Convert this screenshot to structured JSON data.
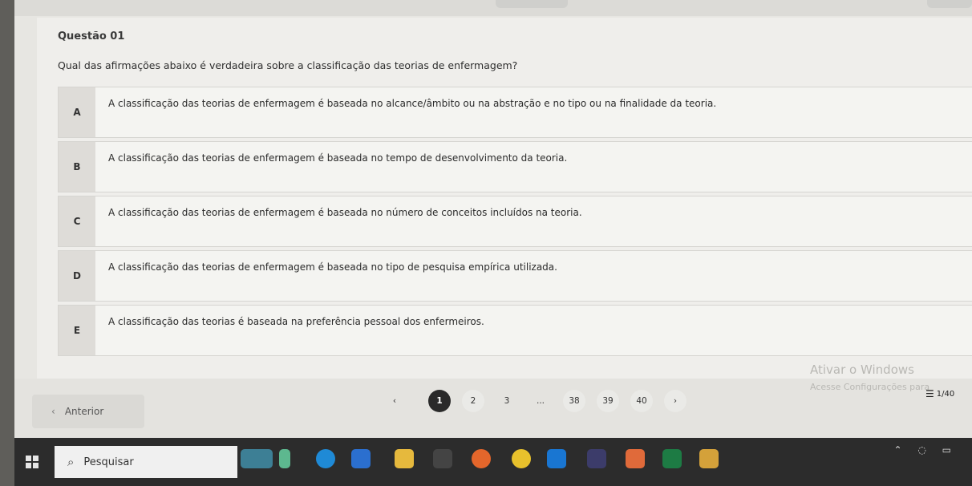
{
  "question": {
    "title": "Questão 01",
    "text": "Qual das afirmações abaixo é verdadeira sobre a classificação das teorias de enfermagem?"
  },
  "options": [
    {
      "letter": "A",
      "text": "A classificação das teorias de enfermagem é baseada no alcance/âmbito ou na abstração e no tipo ou na finalidade da teoria."
    },
    {
      "letter": "B",
      "text": "A classificação das teorias de enfermagem é baseada no tempo de desenvolvimento da teoria."
    },
    {
      "letter": "C",
      "text": "A classificação das teorias de enfermagem é baseada no número de conceitos incluídos na teoria."
    },
    {
      "letter": "D",
      "text": "A classificação das teorias de enfermagem é baseada no tipo de pesquisa empírica utilizada."
    },
    {
      "letter": "E",
      "text": "A classificação das teorias é baseada na preferência pessoal dos enfermeiros."
    }
  ],
  "navigation": {
    "prev_label": "Anterior",
    "prev_icon": "chevron-left-icon",
    "pages": [
      "1",
      "2",
      "3",
      "...",
      "38",
      "39",
      "40"
    ],
    "current_page": "1",
    "pager_prev_icon": "‹",
    "pager_next_icon": "›",
    "counter": "1/40",
    "counter_icon": "menu-icon"
  },
  "watermark": {
    "title": "Ativar o Windows",
    "subtitle": "Acesse Configurações para"
  },
  "taskbar": {
    "search_placeholder": "Pesquisar",
    "icons": [
      "weather-icon",
      "file-icon",
      "edge-icon",
      "store-icon",
      "folder-icon",
      "calculator-icon",
      "firefox-icon",
      "chrome-icon",
      "outlook-icon",
      "media-icon",
      "app-icon",
      "excel-icon",
      "photos-icon"
    ],
    "colors": {
      "edge": "#1f8ad6",
      "chrome": "#e8c12c",
      "excel": "#1d7b44",
      "outlook": "#1976d2",
      "firefox": "#e4662b"
    }
  }
}
